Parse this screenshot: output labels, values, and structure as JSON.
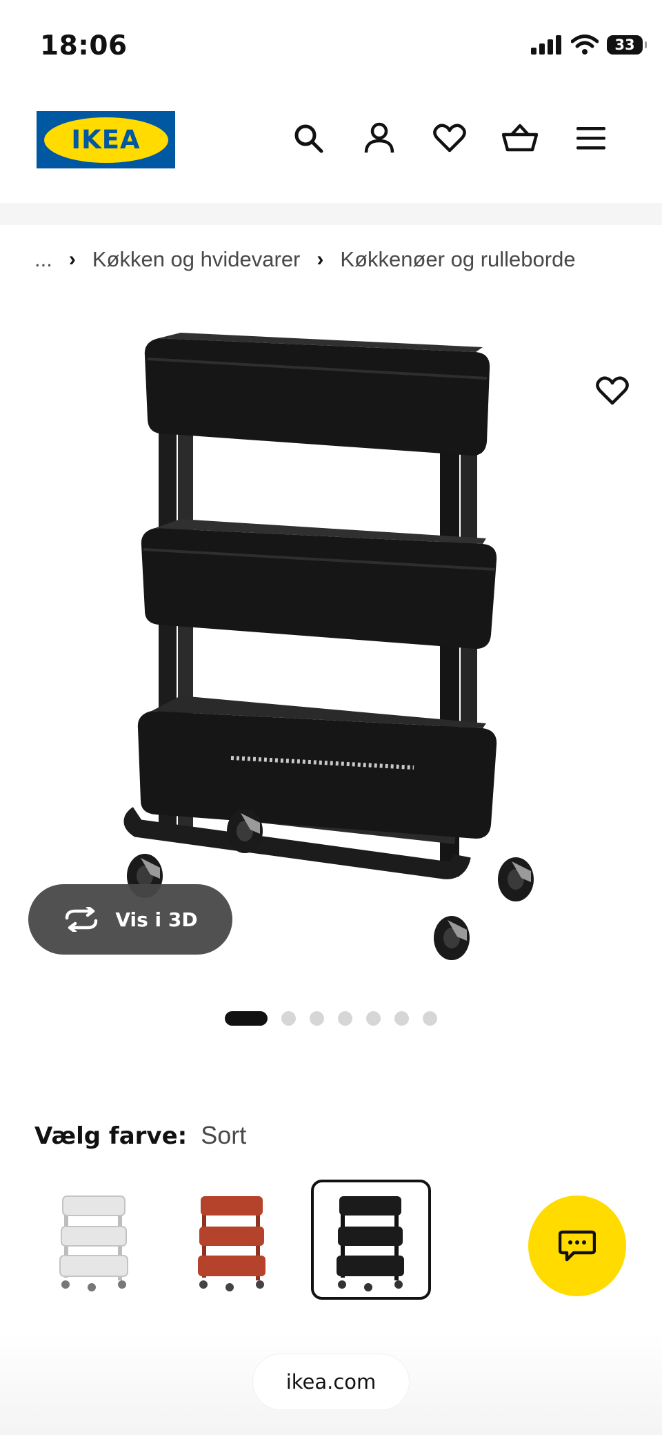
{
  "status_bar": {
    "time": "18:06",
    "battery": "33",
    "icons": [
      "cellular-signal-icon",
      "wifi-icon",
      "battery-icon"
    ]
  },
  "header": {
    "logo_text": "IKEA",
    "brand_colors": {
      "blue": "#0058a3",
      "yellow": "#ffdb00"
    },
    "icons": [
      "search-icon",
      "account-icon",
      "favourites-heart-icon",
      "shopping-basket-icon",
      "menu-icon"
    ]
  },
  "breadcrumb": {
    "ellipsis": "...",
    "items": [
      "Køkken og hvidevarer",
      "Køkkenøer og rulleborde"
    ]
  },
  "product_gallery": {
    "image": "black three-tier kitchen trolley on castor wheels",
    "view_3d_label": "Vis i 3D",
    "favourite_icon": "heart-outline-icon",
    "slide_count": 7,
    "active_slide": 1
  },
  "colour_selector": {
    "label": "Vælg farve:",
    "selected_value": "Sort",
    "options": [
      {
        "colour": "white",
        "hex": "#f1f1f1"
      },
      {
        "colour": "red-brown",
        "hex": "#b5432c"
      },
      {
        "colour": "black",
        "hex": "#1b1b1b",
        "selected": true
      }
    ]
  },
  "chat_button": {
    "icon": "chat-bubble-icon",
    "color": "#ffdb00"
  },
  "browser": {
    "url": "ikea.com"
  }
}
